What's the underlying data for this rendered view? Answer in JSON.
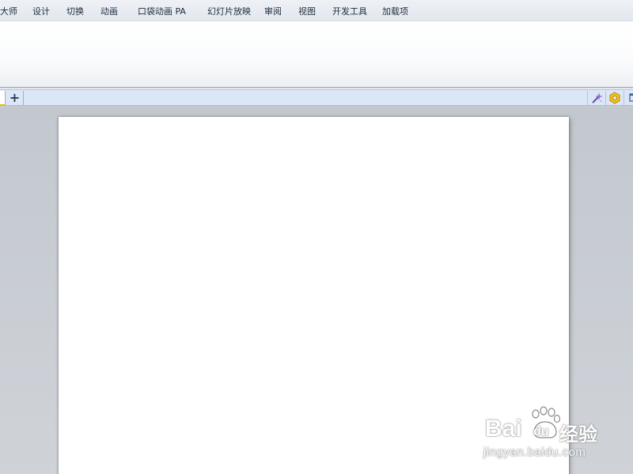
{
  "ribbon": {
    "tabs": [
      {
        "id": "design-master",
        "label": "大师"
      },
      {
        "id": "design",
        "label": "设计"
      },
      {
        "id": "transitions",
        "label": "切换"
      },
      {
        "id": "animations",
        "label": "动画"
      },
      {
        "id": "pocket-animation",
        "label": "口袋动画 PA"
      },
      {
        "id": "slideshow",
        "label": "幻灯片放映"
      },
      {
        "id": "review",
        "label": "审阅"
      },
      {
        "id": "view",
        "label": "视图"
      },
      {
        "id": "developer",
        "label": "开发工具"
      },
      {
        "id": "addins",
        "label": "加载项"
      }
    ]
  },
  "doc_tabs": {
    "add_label": "+",
    "accent_color": "#f5b400",
    "right_icons": [
      "magic-wand-icon",
      "settings-icon",
      "window-icon"
    ]
  },
  "watermark": {
    "brand": "Bai",
    "paw": "du",
    "suffix": "经验",
    "url": "jingyan.baidu.com"
  }
}
